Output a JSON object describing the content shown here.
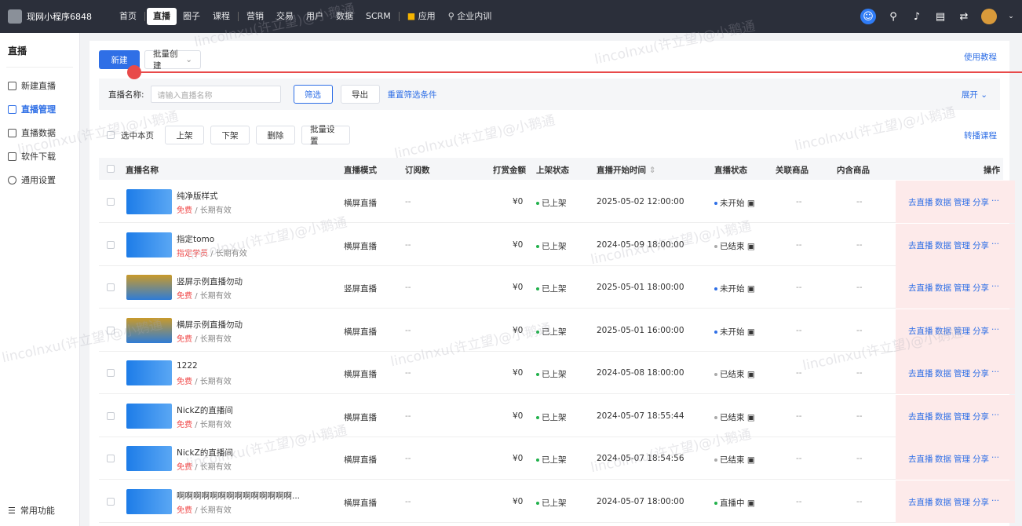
{
  "app": {
    "name": "现网小程序6848"
  },
  "nav": [
    "首页",
    "直播",
    "圈子",
    "课程",
    "营销",
    "交易",
    "用户",
    "数据",
    "SCRM",
    "应用",
    "企业内训"
  ],
  "sidebar": {
    "title": "直播",
    "items": [
      "新建直播",
      "直播管理",
      "直播数据",
      "软件下载",
      "通用设置"
    ],
    "footer": "常用功能"
  },
  "toolbar": {
    "new": "新建",
    "batch_create": "批量创建",
    "help": "使用教程"
  },
  "filter": {
    "label": "直播名称:",
    "placeholder": "请输入直播名称",
    "filter_btn": "筛选",
    "export_btn": "导出",
    "reset": "重置筛选条件",
    "expand": "展开"
  },
  "actions": {
    "select_page": "选中本页",
    "up": "上架",
    "down": "下架",
    "delete": "删除",
    "batch": "批量设置",
    "transfer": "转播课程"
  },
  "columns": [
    "直播名称",
    "直播模式",
    "订阅数",
    "打赏金额",
    "上架状态",
    "直播开始时间",
    "直播状态",
    "关联商品",
    "内含商品",
    "操作"
  ],
  "ops": [
    "去直播",
    "数据",
    "管理",
    "分享",
    "···"
  ],
  "watermark": "lincolnxu(许立望)@小鹅通",
  "rows": [
    {
      "title": "纯净版样式",
      "price": "免费",
      "validity": "/ 长期有效",
      "mode": "横屏直播",
      "subs": "--",
      "reward": "¥0",
      "shelf": "已上架",
      "start": "2025-05-02 12:00:00",
      "status": "未开始",
      "rel": "--",
      "inc": "--",
      "thumb": "blue"
    },
    {
      "title": "指定tomo",
      "price": "指定学员",
      "validity": "/ 长期有效",
      "mode": "横屏直播",
      "subs": "--",
      "reward": "¥0",
      "shelf": "已上架",
      "start": "2024-05-09 18:00:00",
      "status": "已结束",
      "rel": "--",
      "inc": "--",
      "thumb": "blue"
    },
    {
      "title": "竖屏示例直播勿动",
      "price": "免费",
      "validity": "/ 长期有效",
      "mode": "竖屏直播",
      "subs": "--",
      "reward": "¥0",
      "shelf": "已上架",
      "start": "2025-05-01 18:00:00",
      "status": "未开始",
      "rel": "--",
      "inc": "--",
      "thumb": "gold"
    },
    {
      "title": "横屏示例直播勿动",
      "price": "免费",
      "validity": "/ 长期有效",
      "mode": "横屏直播",
      "subs": "--",
      "reward": "¥0",
      "shelf": "已上架",
      "start": "2025-05-01 16:00:00",
      "status": "未开始",
      "rel": "--",
      "inc": "--",
      "thumb": "gold"
    },
    {
      "title": "1222",
      "price": "免费",
      "validity": "/ 长期有效",
      "mode": "横屏直播",
      "subs": "--",
      "reward": "¥0",
      "shelf": "已上架",
      "start": "2024-05-08 18:00:00",
      "status": "已结束",
      "rel": "--",
      "inc": "--",
      "thumb": "blue"
    },
    {
      "title": "NickZ的直播间",
      "price": "免费",
      "validity": "/ 长期有效",
      "mode": "横屏直播",
      "subs": "--",
      "reward": "¥0",
      "shelf": "已上架",
      "start": "2024-05-07 18:55:44",
      "status": "已结束",
      "rel": "--",
      "inc": "--",
      "thumb": "blue"
    },
    {
      "title": "NickZ的直播间",
      "price": "免费",
      "validity": "/ 长期有效",
      "mode": "横屏直播",
      "subs": "--",
      "reward": "¥0",
      "shelf": "已上架",
      "start": "2024-05-07 18:54:56",
      "status": "已结束",
      "rel": "--",
      "inc": "--",
      "thumb": "blue"
    },
    {
      "title": "啊啊啊啊啊啊啊啊啊啊啊啊啊啊...",
      "price": "免费",
      "validity": "/ 长期有效",
      "mode": "横屏直播",
      "subs": "--",
      "reward": "¥0",
      "shelf": "已上架",
      "start": "2024-05-07 18:00:00",
      "status": "直播中",
      "rel": "--",
      "inc": "--",
      "thumb": "blue"
    }
  ]
}
